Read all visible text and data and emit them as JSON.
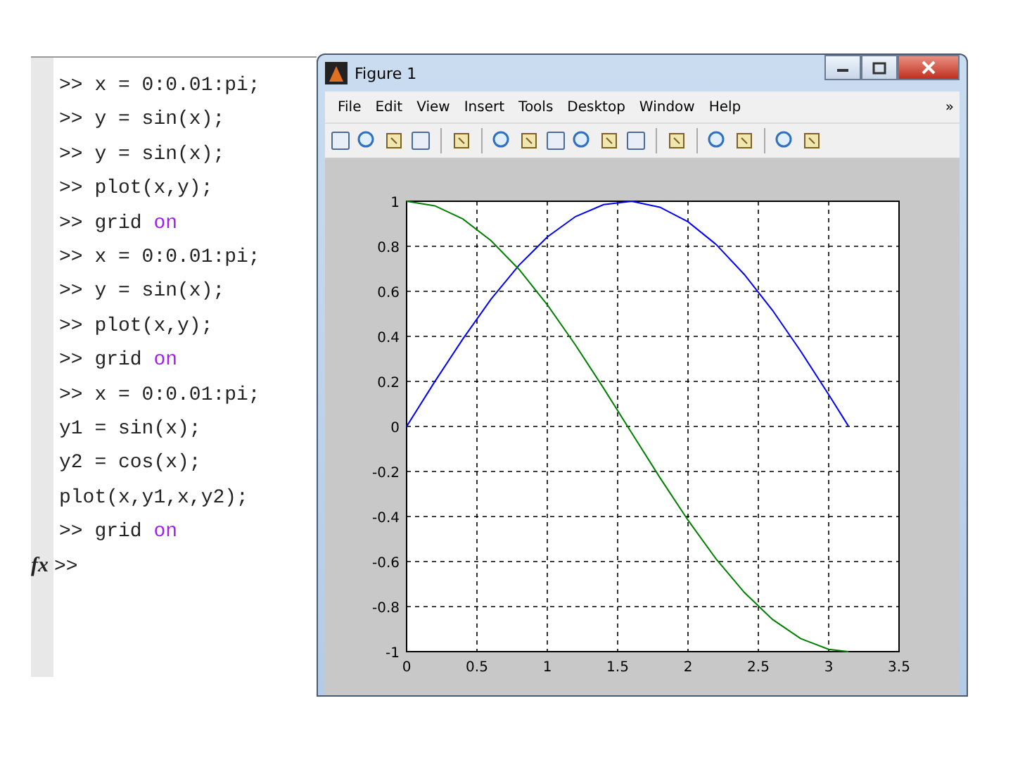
{
  "command_window": {
    "lines": [
      {
        "prompt": ">>",
        "code": "x = 0:0.01:pi;"
      },
      {
        "prompt": ">>",
        "code": "y = sin(x);"
      },
      {
        "prompt": ">>",
        "code": "y = sin(x);"
      },
      {
        "prompt": ">>",
        "code": "plot(x,y);"
      },
      {
        "prompt": ">>",
        "code": "grid",
        "keyword": "on"
      },
      {
        "prompt": ">>",
        "code": "x = 0:0.01:pi;"
      },
      {
        "prompt": ">>",
        "code": "y = sin(x);"
      },
      {
        "prompt": ">>",
        "code": "plot(x,y);"
      },
      {
        "prompt": ">>",
        "code": "grid",
        "keyword": "on"
      },
      {
        "prompt": ">>",
        "code": "x = 0:0.01:pi;"
      },
      {
        "code": "y1 = sin(x);"
      },
      {
        "code": "y2 = cos(x);"
      },
      {
        "code": "plot(x,y1,x,y2);"
      },
      {
        "prompt": ">>",
        "code": "grid",
        "keyword": "on"
      }
    ],
    "fx": "fx",
    "current_prompt": ">>"
  },
  "figure_window": {
    "title": "Figure 1",
    "menu": [
      "File",
      "Edit",
      "View",
      "Insert",
      "Tools",
      "Desktop",
      "Window",
      "Help"
    ],
    "menu_overflow": "»",
    "chart_data": {
      "type": "line",
      "x": [
        0,
        0.2,
        0.4,
        0.6,
        0.8,
        1.0,
        1.2,
        1.4,
        1.6,
        1.8,
        2.0,
        2.2,
        2.4,
        2.6,
        2.8,
        3.0,
        3.14
      ],
      "series": [
        {
          "color": "#0000ff",
          "values": [
            0,
            0.199,
            0.389,
            0.565,
            0.717,
            0.841,
            0.932,
            0.985,
            1.0,
            0.974,
            0.909,
            0.808,
            0.675,
            0.516,
            0.335,
            0.141,
            0.002
          ]
        },
        {
          "color": "#008000",
          "values": [
            1,
            0.98,
            0.921,
            0.825,
            0.697,
            0.54,
            0.362,
            0.17,
            -0.029,
            -0.227,
            -0.416,
            -0.589,
            -0.737,
            -0.857,
            -0.942,
            -0.99,
            -1.0
          ]
        }
      ],
      "grid": true,
      "xlim": [
        0,
        3.5
      ],
      "ylim": [
        -1,
        1
      ],
      "xticks": [
        0,
        0.5,
        1,
        1.5,
        2,
        2.5,
        3,
        3.5
      ],
      "yticks": [
        -1,
        -0.8,
        -0.6,
        -0.4,
        -0.2,
        0,
        0.2,
        0.4,
        0.6,
        0.8,
        1
      ]
    }
  }
}
